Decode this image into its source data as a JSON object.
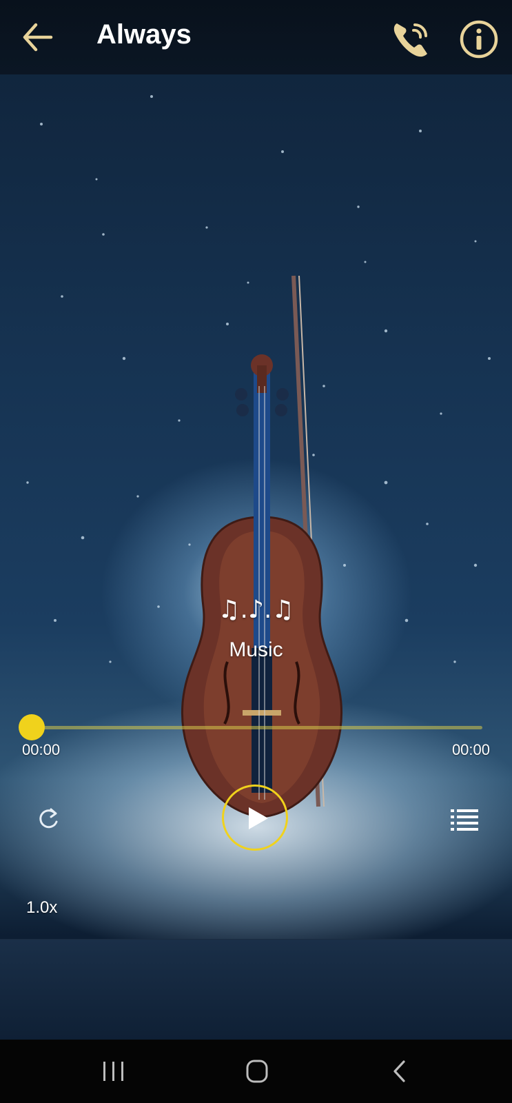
{
  "header": {
    "title": "Always",
    "back_icon": "arrow-left-icon",
    "call_icon": "phone-call-icon",
    "info_icon": "info-icon"
  },
  "player": {
    "notes": "♫.♪.♫",
    "label": "Music",
    "current_time": "00:00",
    "total_time": "00:00",
    "progress": 0,
    "speed": "1.0x",
    "repeat_icon": "repeat-icon",
    "play_icon": "play-icon",
    "playlist_icon": "playlist-icon"
  },
  "colors": {
    "accent": "#f0d21c",
    "header_icon": "#e8d39a"
  },
  "navbar": {
    "recents_icon": "recents-icon",
    "home_icon": "home-icon",
    "back_icon": "nav-back-icon"
  }
}
